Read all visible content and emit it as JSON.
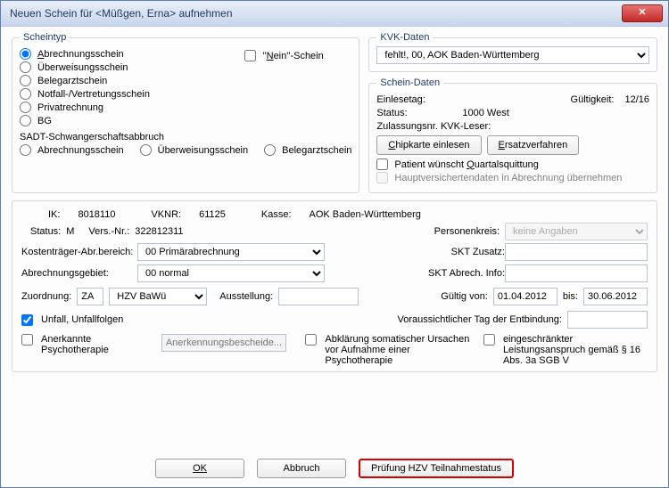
{
  "window": {
    "title": "Neuen Schein für <Müßgen, Erna> aufnehmen"
  },
  "scheintyp": {
    "legend": "Scheintyp",
    "abrechnungsschein": "Abrechnungsschein",
    "ueberweisungsschein": "Überweisungsschein",
    "belegarztschein": "Belegarztschein",
    "notfall": "Notfall-/Vertretungsschein",
    "privatrechnung": "Privatrechnung",
    "bg": "BG",
    "nein_schein": "''Nein''-Schein",
    "sadt_label": "SADT-Schwangerschaftsabbruch",
    "sadt_abrechnung": "Abrechnungsschein",
    "sadt_ueberweisung": "Überweisungsschein",
    "sadt_belegarzt": "Belegarztschein"
  },
  "kvk": {
    "legend": "KVK-Daten",
    "selected": "fehlt!, 00, AOK Baden-Württemberg"
  },
  "scheindaten": {
    "legend": "Schein-Daten",
    "einlesetag_lbl": "Einlesetag:",
    "gueltigkeit_lbl": "Gültigkeit:",
    "gueltigkeit_val": "12/16",
    "status_lbl": "Status:",
    "status_val": "1000 West",
    "zulassung_lbl": "Zulassungsnr. KVK-Leser:",
    "btn_chipkarte": "Chipkarte einlesen",
    "btn_ersatz": "Ersatzverfahren",
    "quartalsquittung": "Patient wünscht Quartalsquittung",
    "hauptversicherte": "Hauptversichertendaten in Abrechnung übernehmen"
  },
  "info": {
    "ik_lbl": "IK:",
    "ik_val": "8018110",
    "vknr_lbl": "VKNR:",
    "vknr_val": "61125",
    "kasse_lbl": "Kasse:",
    "kasse_val": "AOK Baden-Württemberg",
    "status_lbl": "Status:",
    "status_val": "M",
    "versnr_lbl": "Vers.-Nr.:",
    "versnr_val": "322812311",
    "kostentraeger_lbl": "Kostenträger-Abr.bereich:",
    "kostentraeger_sel": "00 Primärabrechnung",
    "abrechgebiet_lbl": "Abrechnungsgebiet:",
    "abrechgebiet_sel": "00 normal",
    "personenkreis_lbl": "Personenkreis:",
    "personenkreis_sel": "keine Angaben",
    "skt_zusatz_lbl": "SKT Zusatz:",
    "skt_abrech_lbl": "SKT Abrech. Info:"
  },
  "zuord": {
    "zuordnung_lbl": "Zuordnung:",
    "za": "ZA",
    "hzv": "HZV BaWü",
    "ausstellung_lbl": "Ausstellung:",
    "gueltig_von_lbl": "Gültig von:",
    "gueltig_von_val": "01.04.2012",
    "bis_lbl": "bis:",
    "bis_val": "30.06.2012",
    "unfall": "Unfall, Unfallfolgen",
    "entbindung_lbl": "Voraussichtlicher Tag der Entbindung:",
    "psych": "Anerkannte Psychotherapie",
    "anerkennung_ph": "Anerkennungsbescheide...",
    "abklaerung": "Abklärung somatischer Ursachen vor Aufnahme einer Psychotherapie",
    "eingeschraenkt": "eingeschränkter Leistungsanspruch gemäß § 16 Abs. 3a SGB V"
  },
  "footer": {
    "ok": "OK",
    "abbruch": "Abbruch",
    "hzv": "Prüfung HZV Teilnahmestatus"
  }
}
